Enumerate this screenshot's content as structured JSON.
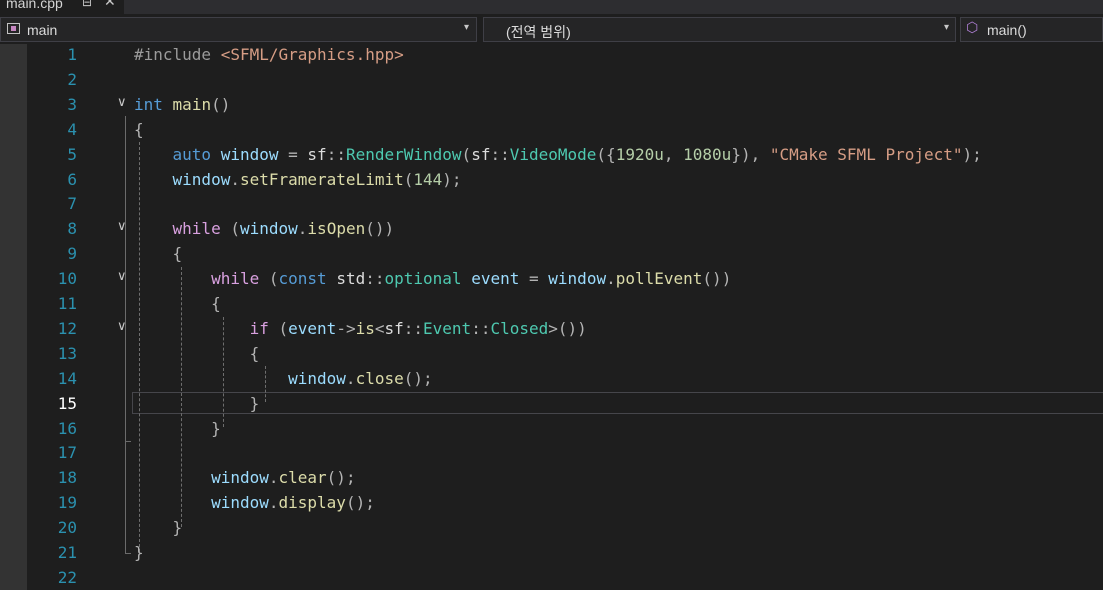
{
  "tab": {
    "label": "main.cpp",
    "pin_icon": "pin-icon",
    "close_icon": "close-icon"
  },
  "navbar": {
    "project": {
      "label": "main",
      "icon": "project-icon"
    },
    "scope": {
      "label": "(전역 범위)"
    },
    "member": {
      "label": "main()",
      "icon": "method-icon"
    },
    "dropdown_icon": "chevron-down-icon"
  },
  "editor": {
    "current_line": 15,
    "lines": [
      {
        "num": "1",
        "tokens": [
          [
            "pp",
            "#include "
          ],
          [
            "s",
            "<SFML/Graphics.hpp>"
          ]
        ]
      },
      {
        "num": "2",
        "tokens": []
      },
      {
        "num": "3",
        "fold": true,
        "tokens": [
          [
            "k",
            "int"
          ],
          [
            "",
            " "
          ],
          [
            "f",
            "main"
          ],
          [
            "p",
            "()"
          ]
        ]
      },
      {
        "num": "4",
        "tokens": [
          [
            "p",
            "{"
          ]
        ]
      },
      {
        "num": "5",
        "tokens": [
          [
            "",
            "    "
          ],
          [
            "k",
            "auto"
          ],
          [
            "",
            " "
          ],
          [
            "v",
            "window"
          ],
          [
            "",
            " "
          ],
          [
            "p",
            "="
          ],
          [
            "",
            " sf"
          ],
          [
            "p",
            "::"
          ],
          [
            "t",
            "RenderWindow"
          ],
          [
            "p",
            "("
          ],
          [
            "",
            "sf"
          ],
          [
            "p",
            "::"
          ],
          [
            "t",
            "VideoMode"
          ],
          [
            "p",
            "({"
          ],
          [
            "n",
            "1920u"
          ],
          [
            "p",
            ","
          ],
          [
            "",
            " "
          ],
          [
            "n",
            "1080u"
          ],
          [
            "p",
            "}),"
          ],
          [
            "",
            " "
          ],
          [
            "s",
            "\"CMake SFML Project\""
          ],
          [
            "p",
            ");"
          ]
        ]
      },
      {
        "num": "6",
        "tokens": [
          [
            "",
            "    "
          ],
          [
            "v",
            "window"
          ],
          [
            "p",
            "."
          ],
          [
            "f",
            "setFramerateLimit"
          ],
          [
            "p",
            "("
          ],
          [
            "n",
            "144"
          ],
          [
            "p",
            ");"
          ]
        ]
      },
      {
        "num": "7",
        "tokens": []
      },
      {
        "num": "8",
        "fold": true,
        "tokens": [
          [
            "",
            "    "
          ],
          [
            "ctl",
            "while"
          ],
          [
            "",
            " "
          ],
          [
            "p",
            "("
          ],
          [
            "v",
            "window"
          ],
          [
            "p",
            "."
          ],
          [
            "f",
            "isOpen"
          ],
          [
            "p",
            "())"
          ]
        ]
      },
      {
        "num": "9",
        "tokens": [
          [
            "",
            "    "
          ],
          [
            "p",
            "{"
          ]
        ]
      },
      {
        "num": "10",
        "fold": true,
        "tokens": [
          [
            "",
            "        "
          ],
          [
            "ctl",
            "while"
          ],
          [
            "",
            " "
          ],
          [
            "p",
            "("
          ],
          [
            "k",
            "const"
          ],
          [
            "",
            " std"
          ],
          [
            "p",
            "::"
          ],
          [
            "t",
            "optional"
          ],
          [
            "",
            " "
          ],
          [
            "v",
            "event"
          ],
          [
            "",
            " "
          ],
          [
            "p",
            "="
          ],
          [
            "",
            " "
          ],
          [
            "v",
            "window"
          ],
          [
            "p",
            "."
          ],
          [
            "f",
            "pollEvent"
          ],
          [
            "p",
            "())"
          ]
        ]
      },
      {
        "num": "11",
        "tokens": [
          [
            "",
            "        "
          ],
          [
            "p",
            "{"
          ]
        ]
      },
      {
        "num": "12",
        "fold": true,
        "tokens": [
          [
            "",
            "            "
          ],
          [
            "ctl",
            "if"
          ],
          [
            "",
            " "
          ],
          [
            "p",
            "("
          ],
          [
            "v",
            "event"
          ],
          [
            "p",
            "->"
          ],
          [
            "f",
            "is"
          ],
          [
            "p",
            "<"
          ],
          [
            "",
            "sf"
          ],
          [
            "p",
            "::"
          ],
          [
            "t",
            "Event"
          ],
          [
            "p",
            "::"
          ],
          [
            "t",
            "Closed"
          ],
          [
            "p",
            ">())"
          ]
        ]
      },
      {
        "num": "13",
        "tokens": [
          [
            "",
            "            "
          ],
          [
            "p",
            "{"
          ]
        ]
      },
      {
        "num": "14",
        "tokens": [
          [
            "",
            "                "
          ],
          [
            "v",
            "window"
          ],
          [
            "p",
            "."
          ],
          [
            "f",
            "close"
          ],
          [
            "p",
            "();"
          ]
        ]
      },
      {
        "num": "15",
        "tokens": [
          [
            "",
            "            "
          ],
          [
            "p",
            "}"
          ]
        ]
      },
      {
        "num": "16",
        "tokens": [
          [
            "",
            "        "
          ],
          [
            "p",
            "}"
          ]
        ]
      },
      {
        "num": "17",
        "tokens": []
      },
      {
        "num": "18",
        "tokens": [
          [
            "",
            "        "
          ],
          [
            "v",
            "window"
          ],
          [
            "p",
            "."
          ],
          [
            "f",
            "clear"
          ],
          [
            "p",
            "();"
          ]
        ]
      },
      {
        "num": "19",
        "tokens": [
          [
            "",
            "        "
          ],
          [
            "v",
            "window"
          ],
          [
            "p",
            "."
          ],
          [
            "f",
            "display"
          ],
          [
            "p",
            "();"
          ]
        ]
      },
      {
        "num": "20",
        "tokens": [
          [
            "",
            "    "
          ],
          [
            "p",
            "}"
          ]
        ]
      },
      {
        "num": "21",
        "tokens": [
          [
            "p",
            "}"
          ]
        ]
      },
      {
        "num": "22",
        "tokens": []
      }
    ]
  }
}
